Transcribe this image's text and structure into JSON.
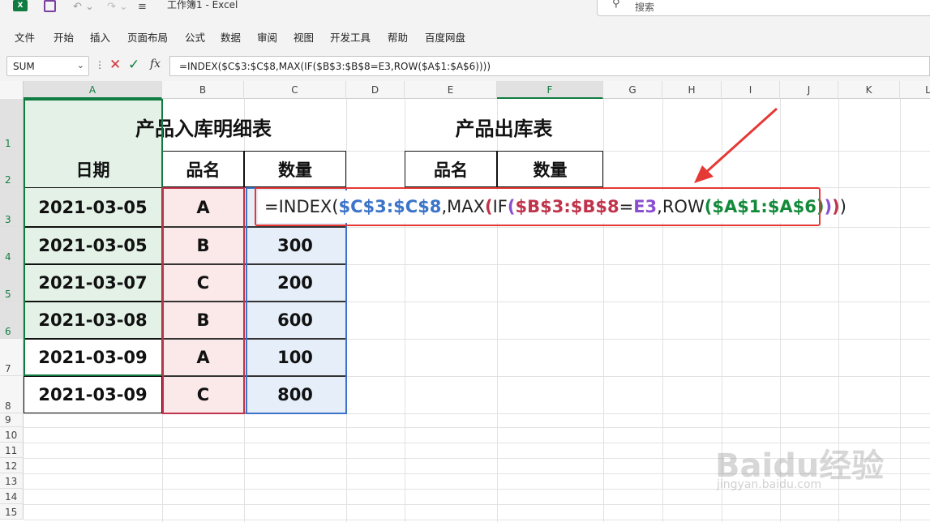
{
  "titlebar": {
    "app_logo": "X",
    "title": "工作簿1  -  Excel",
    "search_placeholder": "搜索",
    "icons": [
      "excel-logo",
      "save-icon",
      "undo-icon",
      "redo-icon",
      "customize-qat-icon",
      "search-icon"
    ]
  },
  "ribbon": {
    "tabs": [
      "文件",
      "开始",
      "插入",
      "页面布局",
      "公式",
      "数据",
      "审阅",
      "视图",
      "开发工具",
      "帮助",
      "百度网盘"
    ]
  },
  "formula_bar": {
    "name_box": "SUM",
    "formula": "=INDEX($C$3:$C$8,MAX(IF($B$3:$B$8=E3,ROW($A$1:$A$6))))",
    "cancel": "✕",
    "enter": "✓",
    "fx": "fx"
  },
  "grid": {
    "columns": [
      "A",
      "B",
      "C",
      "D",
      "E",
      "F",
      "G",
      "H",
      "I",
      "J",
      "K",
      "L"
    ],
    "selected_columns": [
      "A",
      "F"
    ],
    "rows": [
      "1",
      "2",
      "3",
      "4",
      "5",
      "6",
      "7",
      "8",
      "9",
      "10",
      "11",
      "12",
      "13",
      "14",
      "15"
    ],
    "selected_rows": [
      "1",
      "2",
      "3",
      "4",
      "5",
      "6"
    ],
    "inbound_title": "产品入库明细表",
    "inbound_headers": [
      "日期",
      "品名",
      "数量"
    ],
    "inbound_rows": [
      [
        "2021-03-05",
        "A",
        ""
      ],
      [
        "2021-03-05",
        "B",
        "300"
      ],
      [
        "2021-03-07",
        "C",
        "200"
      ],
      [
        "2021-03-08",
        "B",
        "600"
      ],
      [
        "2021-03-09",
        "A",
        "100"
      ],
      [
        "2021-03-09",
        "C",
        "800"
      ]
    ],
    "outbound_title": "产品出库表",
    "outbound_headers": [
      "品名",
      "数量"
    ],
    "colors": {
      "date_fill": "#e3f1e7",
      "name_fill": "#fbe9ea",
      "qty_fill": "#e6eef9",
      "accent": "#107c41",
      "highlight_red": "#e53935"
    }
  },
  "formula_edit": {
    "parts": [
      {
        "t": "=INDEX(",
        "c": "plain"
      },
      {
        "t": "$C$3:$C$8",
        "c": "blue"
      },
      {
        "t": ",MAX",
        "c": "plain"
      },
      {
        "t": "(",
        "c": "red"
      },
      {
        "t": "IF",
        "c": "plain"
      },
      {
        "t": "(",
        "c": "purple"
      },
      {
        "t": "$B$3:$B$8",
        "c": "red"
      },
      {
        "t": "=",
        "c": "plain"
      },
      {
        "t": "E3",
        "c": "purple"
      },
      {
        "t": ",ROW",
        "c": "plain"
      },
      {
        "t": "(",
        "c": "green"
      },
      {
        "t": "$A$1:$A$6",
        "c": "green"
      },
      {
        "t": ")",
        "c": "green"
      },
      {
        "t": ")",
        "c": "purple"
      },
      {
        "t": ")",
        "c": "red"
      },
      {
        "t": ")",
        "c": "plain"
      }
    ]
  },
  "watermark": {
    "brand": "Baidu经验",
    "url": "jingyan.baidu.com"
  }
}
